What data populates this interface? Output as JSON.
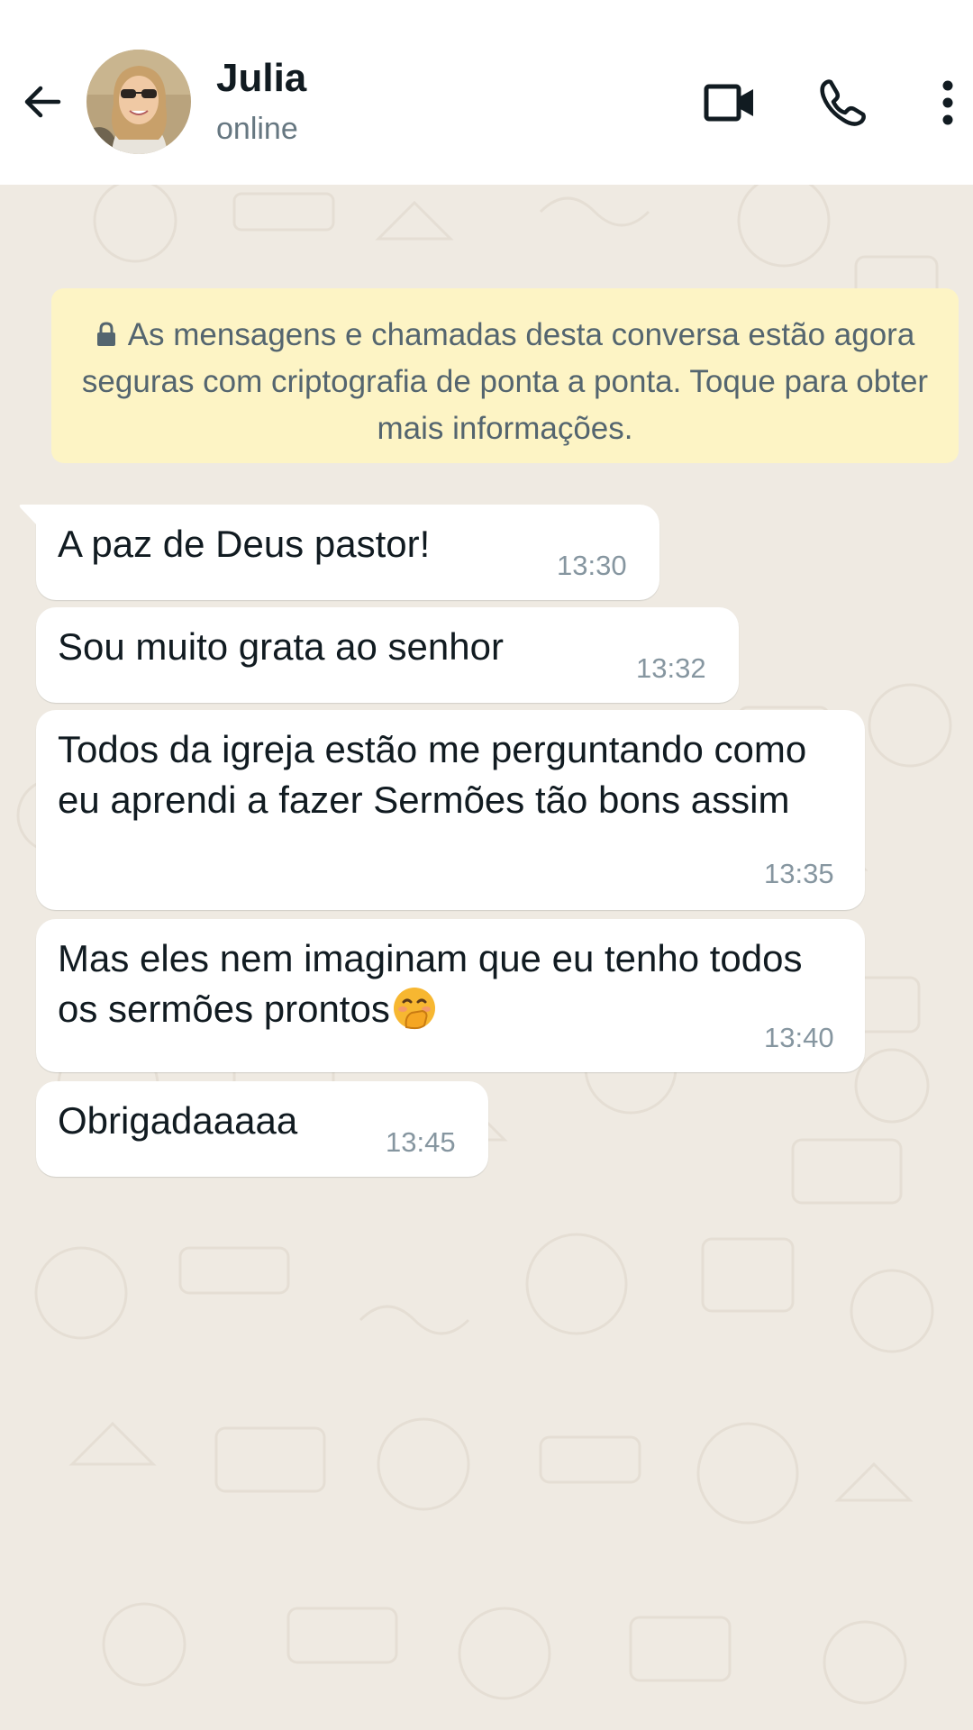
{
  "contact": {
    "name": "Julia",
    "status": "online"
  },
  "header_icons": {
    "back": "arrow-left-icon",
    "video": "video-camera-icon",
    "call": "phone-icon",
    "menu": "more-vertical-icon"
  },
  "encryption_notice": {
    "text": "As mensagens e chamadas desta conversa estão agora seguras com criptografia de ponta a ponta. Toque para obter mais informações.",
    "icon": "lock-icon"
  },
  "messages": [
    {
      "text": "A paz de Deus pastor!",
      "time": "13:30"
    },
    {
      "text": "Sou muito grata ao senhor",
      "time": "13:32"
    },
    {
      "text": "Todos da igreja estão me perguntando como eu aprendi a fazer Sermões tão bons assim",
      "time": "13:35"
    },
    {
      "text": "Mas eles nem imaginam que eu tenho todos os sermões prontos",
      "time": "13:40",
      "emoji": "face-with-hand-over-mouth-emoji"
    },
    {
      "text": "Obrigadaaaaa",
      "time": "13:45"
    }
  ],
  "colors": {
    "chat_background": "#efeae2",
    "header_background": "#ffffff",
    "incoming_bubble": "#ffffff",
    "encryption_banner": "#fdf4c5",
    "timestamp": "#8696a0"
  }
}
